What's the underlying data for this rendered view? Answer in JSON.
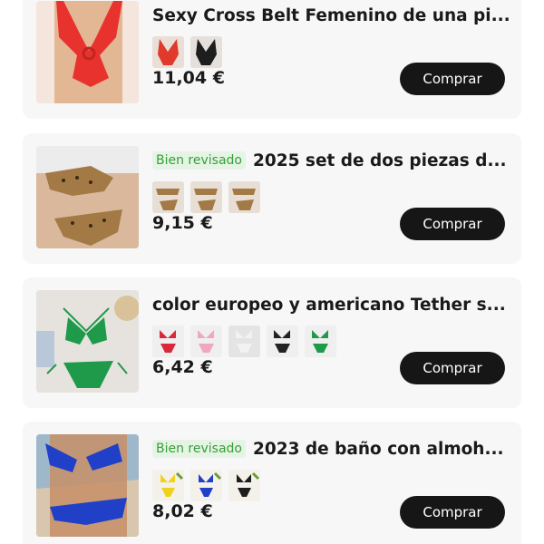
{
  "products": [
    {
      "badge": "",
      "title": "Sexy Cross Belt Femenino de una pi...",
      "price": "11,04 €",
      "buy_label": "Comprar",
      "image_color": "#e8322e",
      "variant_colors": [
        "#e03a2c",
        "#1e1e1e"
      ]
    },
    {
      "badge": "Bien revisado",
      "title": "2025 set de dos piezas d...",
      "price": "9,15 €",
      "buy_label": "Comprar",
      "image_color": "#a37a45",
      "variant_colors": [
        "#a37a45",
        "#a37a45",
        "#a37a45"
      ]
    },
    {
      "badge": "",
      "title": "color europeo y americano Tether s...",
      "price": "6,42 €",
      "buy_label": "Comprar",
      "image_color": "#1f9a4a",
      "variant_colors": [
        "#d9283a",
        "#f1a6c2",
        "#f2f2f2",
        "#222222",
        "#1f9a4a"
      ]
    },
    {
      "badge": "Bien revisado",
      "title": "2023 de baño con almoh...",
      "price": "8,02 €",
      "buy_label": "Comprar",
      "image_color": "#2140c8",
      "variant_colors": [
        "#f1d21a",
        "#2140c8",
        "#1e1e1e"
      ]
    }
  ]
}
